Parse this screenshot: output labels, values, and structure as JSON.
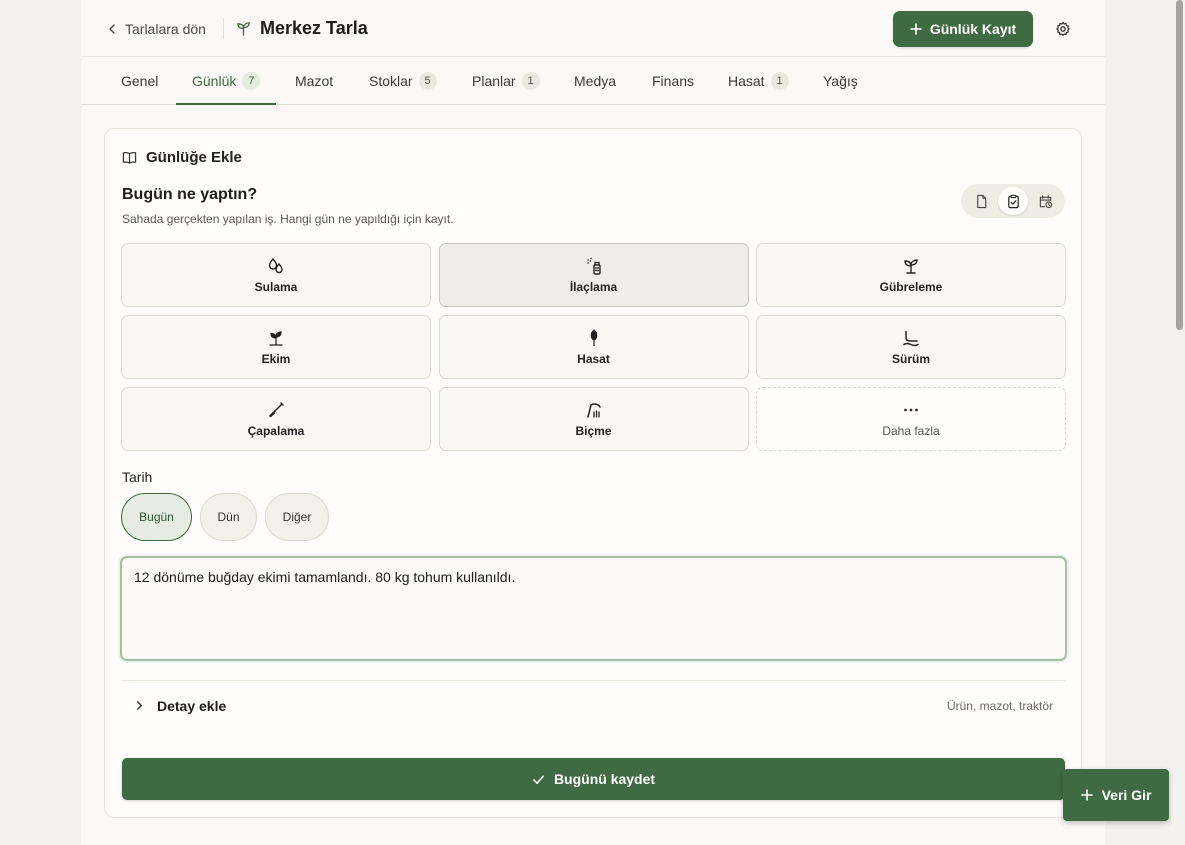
{
  "header": {
    "back_label": "Tarlalara dön",
    "field_name": "Merkez Tarla",
    "primary_button": "Günlük Kayıt"
  },
  "tabs": [
    {
      "label": "Genel",
      "count": ""
    },
    {
      "label": "Günlük",
      "count": "7"
    },
    {
      "label": "Mazot",
      "count": ""
    },
    {
      "label": "Stoklar",
      "count": "5"
    },
    {
      "label": "Planlar",
      "count": "1"
    },
    {
      "label": "Medya",
      "count": ""
    },
    {
      "label": "Finans",
      "count": ""
    },
    {
      "label": "Hasat",
      "count": "1"
    },
    {
      "label": "Yağış",
      "count": ""
    }
  ],
  "active_tab": "Günlük",
  "card": {
    "title": "Günlüğe Ekle",
    "question": "Bugün ne yaptın?",
    "subtitle": "Sahada gerçekten yapılan iş. Hangi gün ne yapıldığı için kayıt.",
    "activities": [
      {
        "label": "Sulama",
        "icon": "droplets-icon"
      },
      {
        "label": "İlaçlama",
        "icon": "spray-bottle-icon"
      },
      {
        "label": "Gübreleme",
        "icon": "sprout-icon"
      },
      {
        "label": "Ekim",
        "icon": "seedling-icon"
      },
      {
        "label": "Hasat",
        "icon": "wheat-icon"
      },
      {
        "label": "Sürüm",
        "icon": "plow-icon"
      },
      {
        "label": "Çapalama",
        "icon": "shovel-icon"
      },
      {
        "label": "Biçme",
        "icon": "scythe-icon"
      },
      {
        "label": "Daha fazla",
        "icon": "more-icon"
      }
    ],
    "selected_activity": "İlaçlama",
    "date_label": "Tarih",
    "date_options": [
      "Bugün",
      "Dün",
      "Diğer"
    ],
    "selected_date": "Bugün",
    "note_text": "12 dönüme buğday ekimi tamamlandı. 80 kg tohum kullanıldı.",
    "detail_label": "Detay ekle",
    "detail_hint": "Ürün, mazot, traktör",
    "save_label": "Bugünü kaydet"
  },
  "fab_label": "Veri Gir",
  "colors": {
    "accent": "#3e6b41",
    "background": "#fbf9f5"
  }
}
